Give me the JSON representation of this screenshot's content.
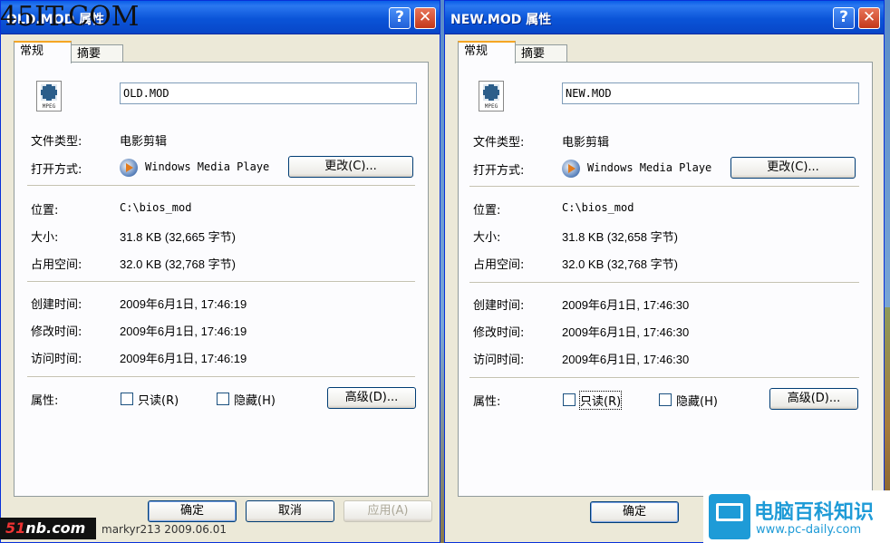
{
  "watermarks": {
    "top_left": "45IT.COM",
    "bottom_left_logo_a": "51",
    "bottom_left_logo_b": "nb.com",
    "bottom_text": "markyr213 2009.06.01",
    "right_title": "电脑百科知识",
    "right_url": "www.pc-daily.com"
  },
  "left_window": {
    "title": "OLD.MOD 属性",
    "tabs": [
      "常规",
      "摘要"
    ],
    "filename": "OLD.MOD",
    "icon_label": "MPEG",
    "file_type_label": "文件类型:",
    "file_type": "电影剪辑",
    "open_with_label": "打开方式:",
    "open_with": "Windows Media Playe",
    "change_button": "更改(C)...",
    "location_label": "位置:",
    "location": "C:\\bios_mod",
    "size_label": "大小:",
    "size": "31.8 KB (32,665 字节)",
    "size_on_disk_label": "占用空间:",
    "size_on_disk": "32.0 KB (32,768 字节)",
    "created_label": "创建时间:",
    "created": "2009年6月1日, 17:46:19",
    "modified_label": "修改时间:",
    "modified": "2009年6月1日, 17:46:19",
    "accessed_label": "访问时间:",
    "accessed": "2009年6月1日, 17:46:19",
    "attributes_label": "属性:",
    "readonly_label": "只读(R)",
    "hidden_label": "隐藏(H)",
    "advanced_button": "高级(D)...",
    "ok_button": "确定",
    "cancel_button": "取消",
    "apply_button": "应用(A)"
  },
  "right_window": {
    "title": "NEW.MOD 属性",
    "tabs": [
      "常规",
      "摘要"
    ],
    "filename": "NEW.MOD",
    "icon_label": "MPEG",
    "file_type_label": "文件类型:",
    "file_type": "电影剪辑",
    "open_with_label": "打开方式:",
    "open_with": "Windows Media Playe",
    "change_button": "更改(C)...",
    "location_label": "位置:",
    "location": "C:\\bios_mod",
    "size_label": "大小:",
    "size": "31.8 KB (32,658 字节)",
    "size_on_disk_label": "占用空间:",
    "size_on_disk": "32.0 KB (32,768 字节)",
    "created_label": "创建时间:",
    "created": "2009年6月1日, 17:46:30",
    "modified_label": "修改时间:",
    "modified": "2009年6月1日, 17:46:30",
    "accessed_label": "访问时间:",
    "accessed": "2009年6月1日, 17:46:30",
    "attributes_label": "属性:",
    "readonly_label": "只读(R)",
    "hidden_label": "隐藏(H)",
    "advanced_button": "高级(D)...",
    "ok_button": "确定"
  }
}
